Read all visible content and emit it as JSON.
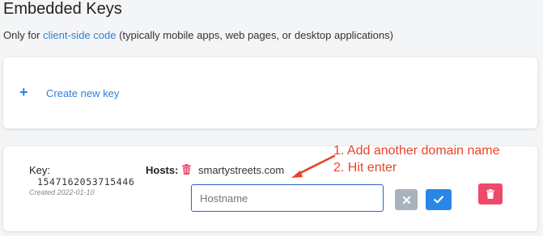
{
  "section": {
    "title": "Embedded Keys",
    "subtitle_prefix": "Only for ",
    "subtitle_link": "client-side code",
    "subtitle_suffix": " (typically mobile apps, web pages, or desktop applications)"
  },
  "create": {
    "icon": "plus-icon",
    "label": "Create new key"
  },
  "key": {
    "label": "Key:",
    "value": "1547162053715446",
    "created": "Created 2022-01-10",
    "hosts_label": "Hosts:",
    "host": "smartystreets.com",
    "input_placeholder": "Hostname",
    "input_value": ""
  },
  "annotation": {
    "line1": "1. Add another domain name",
    "line2": "2. Hit enter",
    "color": "#e8432a"
  },
  "icons": {
    "host_remove": "trash-icon",
    "cancel": "close-icon",
    "confirm": "check-icon",
    "delete": "trash-icon"
  },
  "colors": {
    "link": "#2f7fd8",
    "input_border": "#2f63c6",
    "confirm": "#2a87e8",
    "cancel": "#a9b3bd",
    "delete": "#ef4a6b",
    "trash": "#ef4a6b"
  }
}
